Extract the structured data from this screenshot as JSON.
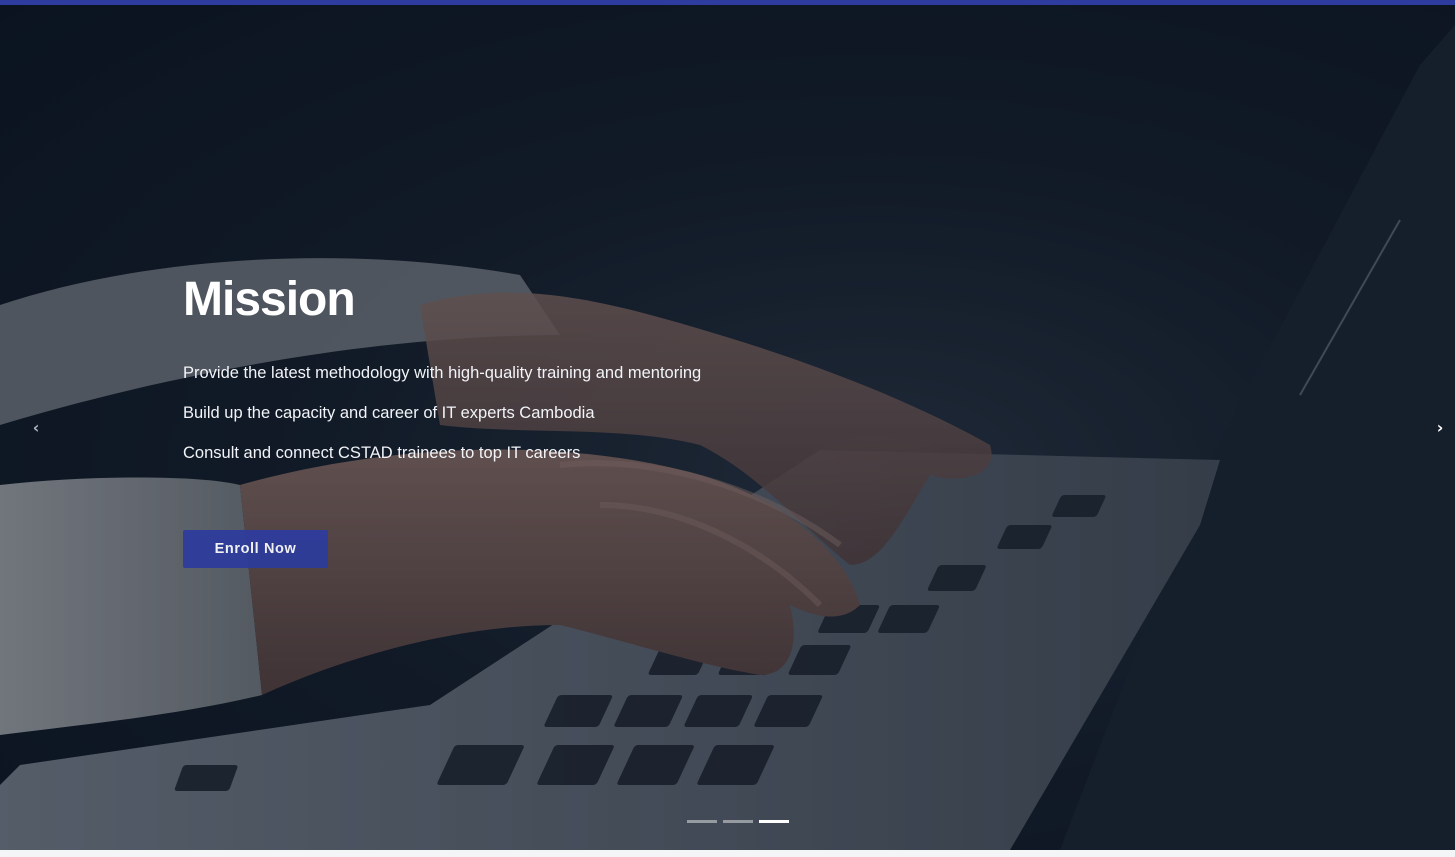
{
  "colors": {
    "accent": "#2d3c9e",
    "text": "#ffffff"
  },
  "slide": {
    "title": "Mission",
    "lines": [
      "Provide the latest methodology with high-quality training and mentoring",
      "Build up the capacity and career of IT experts Cambodia",
      "Consult and connect CSTAD trainees to top IT careers"
    ],
    "button_label": "Enroll Now"
  },
  "carousel": {
    "prev_icon": "chevron-left-icon",
    "next_icon": "chevron-right-icon",
    "prev_glyph": "‹",
    "next_glyph": "›",
    "indicator_count": 3,
    "active_index": 2
  }
}
